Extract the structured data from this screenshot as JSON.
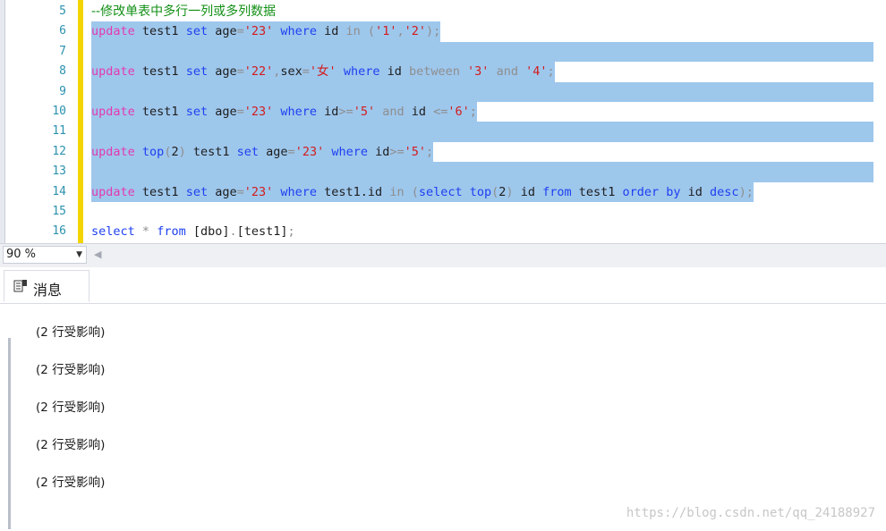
{
  "editor": {
    "lines": [
      {
        "num": "5",
        "segments": [
          {
            "c": "cm",
            "t": "--修改单表中多行一列或多列数据"
          }
        ],
        "hl": false
      },
      {
        "num": "6",
        "segments": [
          {
            "c": "pk",
            "t": "update"
          },
          {
            "c": "tx",
            "t": " test1 "
          },
          {
            "c": "kw",
            "t": "set"
          },
          {
            "c": "tx",
            "t": " age"
          },
          {
            "c": "gr",
            "t": "="
          },
          {
            "c": "str",
            "t": "'23'"
          },
          {
            "c": "tx",
            "t": " "
          },
          {
            "c": "kw",
            "t": "where"
          },
          {
            "c": "tx",
            "t": " id "
          },
          {
            "c": "gr",
            "t": "in ("
          },
          {
            "c": "str",
            "t": "'1'"
          },
          {
            "c": "gr",
            "t": ","
          },
          {
            "c": "str",
            "t": "'2'"
          },
          {
            "c": "gr",
            "t": ");"
          }
        ],
        "hl": true
      },
      {
        "num": "7",
        "segments": [],
        "hl": true
      },
      {
        "num": "8",
        "segments": [
          {
            "c": "pk",
            "t": "update"
          },
          {
            "c": "tx",
            "t": " test1 "
          },
          {
            "c": "kw",
            "t": "set"
          },
          {
            "c": "tx",
            "t": " age"
          },
          {
            "c": "gr",
            "t": "="
          },
          {
            "c": "str",
            "t": "'22'"
          },
          {
            "c": "gr",
            "t": ","
          },
          {
            "c": "tx",
            "t": "sex"
          },
          {
            "c": "gr",
            "t": "="
          },
          {
            "c": "str",
            "t": "'女'"
          },
          {
            "c": "tx",
            "t": " "
          },
          {
            "c": "kw",
            "t": "where"
          },
          {
            "c": "tx",
            "t": " id "
          },
          {
            "c": "gr",
            "t": "between"
          },
          {
            "c": "tx",
            "t": " "
          },
          {
            "c": "str",
            "t": "'3'"
          },
          {
            "c": "tx",
            "t": " "
          },
          {
            "c": "gr",
            "t": "and"
          },
          {
            "c": "tx",
            "t": " "
          },
          {
            "c": "str",
            "t": "'4'"
          },
          {
            "c": "gr",
            "t": ";"
          }
        ],
        "hl": true
      },
      {
        "num": "9",
        "segments": [],
        "hl": true
      },
      {
        "num": "10",
        "segments": [
          {
            "c": "pk",
            "t": "update"
          },
          {
            "c": "tx",
            "t": " test1 "
          },
          {
            "c": "kw",
            "t": "set"
          },
          {
            "c": "tx",
            "t": " age"
          },
          {
            "c": "gr",
            "t": "="
          },
          {
            "c": "str",
            "t": "'23'"
          },
          {
            "c": "tx",
            "t": " "
          },
          {
            "c": "kw",
            "t": "where"
          },
          {
            "c": "tx",
            "t": " id"
          },
          {
            "c": "gr",
            "t": ">="
          },
          {
            "c": "str",
            "t": "'5'"
          },
          {
            "c": "tx",
            "t": " "
          },
          {
            "c": "gr",
            "t": "and"
          },
          {
            "c": "tx",
            "t": " id "
          },
          {
            "c": "gr",
            "t": "<="
          },
          {
            "c": "str",
            "t": "'6'"
          },
          {
            "c": "gr",
            "t": ";"
          }
        ],
        "hl": true
      },
      {
        "num": "11",
        "segments": [],
        "hl": true
      },
      {
        "num": "12",
        "segments": [
          {
            "c": "pk",
            "t": "update"
          },
          {
            "c": "tx",
            "t": " "
          },
          {
            "c": "kw",
            "t": "top"
          },
          {
            "c": "gr",
            "t": "("
          },
          {
            "c": "tx",
            "t": "2"
          },
          {
            "c": "gr",
            "t": ")"
          },
          {
            "c": "tx",
            "t": " test1 "
          },
          {
            "c": "kw",
            "t": "set"
          },
          {
            "c": "tx",
            "t": " age"
          },
          {
            "c": "gr",
            "t": "="
          },
          {
            "c": "str",
            "t": "'23'"
          },
          {
            "c": "tx",
            "t": " "
          },
          {
            "c": "kw",
            "t": "where"
          },
          {
            "c": "tx",
            "t": " id"
          },
          {
            "c": "gr",
            "t": ">="
          },
          {
            "c": "str",
            "t": "'5'"
          },
          {
            "c": "gr",
            "t": ";"
          }
        ],
        "hl": true
      },
      {
        "num": "13",
        "segments": [],
        "hl": true
      },
      {
        "num": "14",
        "segments": [
          {
            "c": "pk",
            "t": "update"
          },
          {
            "c": "tx",
            "t": " test1 "
          },
          {
            "c": "kw",
            "t": "set"
          },
          {
            "c": "tx",
            "t": " age"
          },
          {
            "c": "gr",
            "t": "="
          },
          {
            "c": "str",
            "t": "'23'"
          },
          {
            "c": "tx",
            "t": " "
          },
          {
            "c": "kw",
            "t": "where"
          },
          {
            "c": "tx",
            "t": " test1.id "
          },
          {
            "c": "gr",
            "t": "in ("
          },
          {
            "c": "kw",
            "t": "select"
          },
          {
            "c": "tx",
            "t": " "
          },
          {
            "c": "kw",
            "t": "top"
          },
          {
            "c": "gr",
            "t": "("
          },
          {
            "c": "tx",
            "t": "2"
          },
          {
            "c": "gr",
            "t": ")"
          },
          {
            "c": "tx",
            "t": " id "
          },
          {
            "c": "kw",
            "t": "from"
          },
          {
            "c": "tx",
            "t": " test1 "
          },
          {
            "c": "kw",
            "t": "order by"
          },
          {
            "c": "tx",
            "t": " id "
          },
          {
            "c": "kw",
            "t": "desc"
          },
          {
            "c": "gr",
            "t": ");"
          }
        ],
        "hl": true
      },
      {
        "num": "15",
        "segments": [],
        "hl": false
      },
      {
        "num": "16",
        "segments": [
          {
            "c": "kw",
            "t": "select"
          },
          {
            "c": "tx",
            "t": " "
          },
          {
            "c": "gr",
            "t": "*"
          },
          {
            "c": "tx",
            "t": " "
          },
          {
            "c": "kw",
            "t": "from"
          },
          {
            "c": "tx",
            "t": " [dbo]"
          },
          {
            "c": "gr",
            "t": "."
          },
          {
            "c": "tx",
            "t": "[test1]"
          },
          {
            "c": "gr",
            "t": ";"
          }
        ],
        "hl": false
      }
    ]
  },
  "zoom": {
    "value": "90 %"
  },
  "results": {
    "tab_label": "消息",
    "messages": [
      "(2 行受影响)",
      "(2 行受影响)",
      "(2 行受影响)",
      "(2 行受影响)",
      "(2 行受影响)"
    ]
  },
  "watermark": "https://blog.csdn.net/qq_24188927",
  "colors": {
    "selection": "#9ec7ec",
    "keyword": "#1e40f0",
    "update_keyword": "#e33ab1",
    "string": "#d21c1c",
    "comment": "#128f15",
    "operator": "#8e8e8e",
    "line_number": "#2b91af",
    "change_bar": "#f2d500"
  },
  "icons": {
    "messages_tab": "messages-icon",
    "zoom_caret": "chevron-down-icon",
    "scroll_left": "scroll-left-arrow-icon"
  }
}
